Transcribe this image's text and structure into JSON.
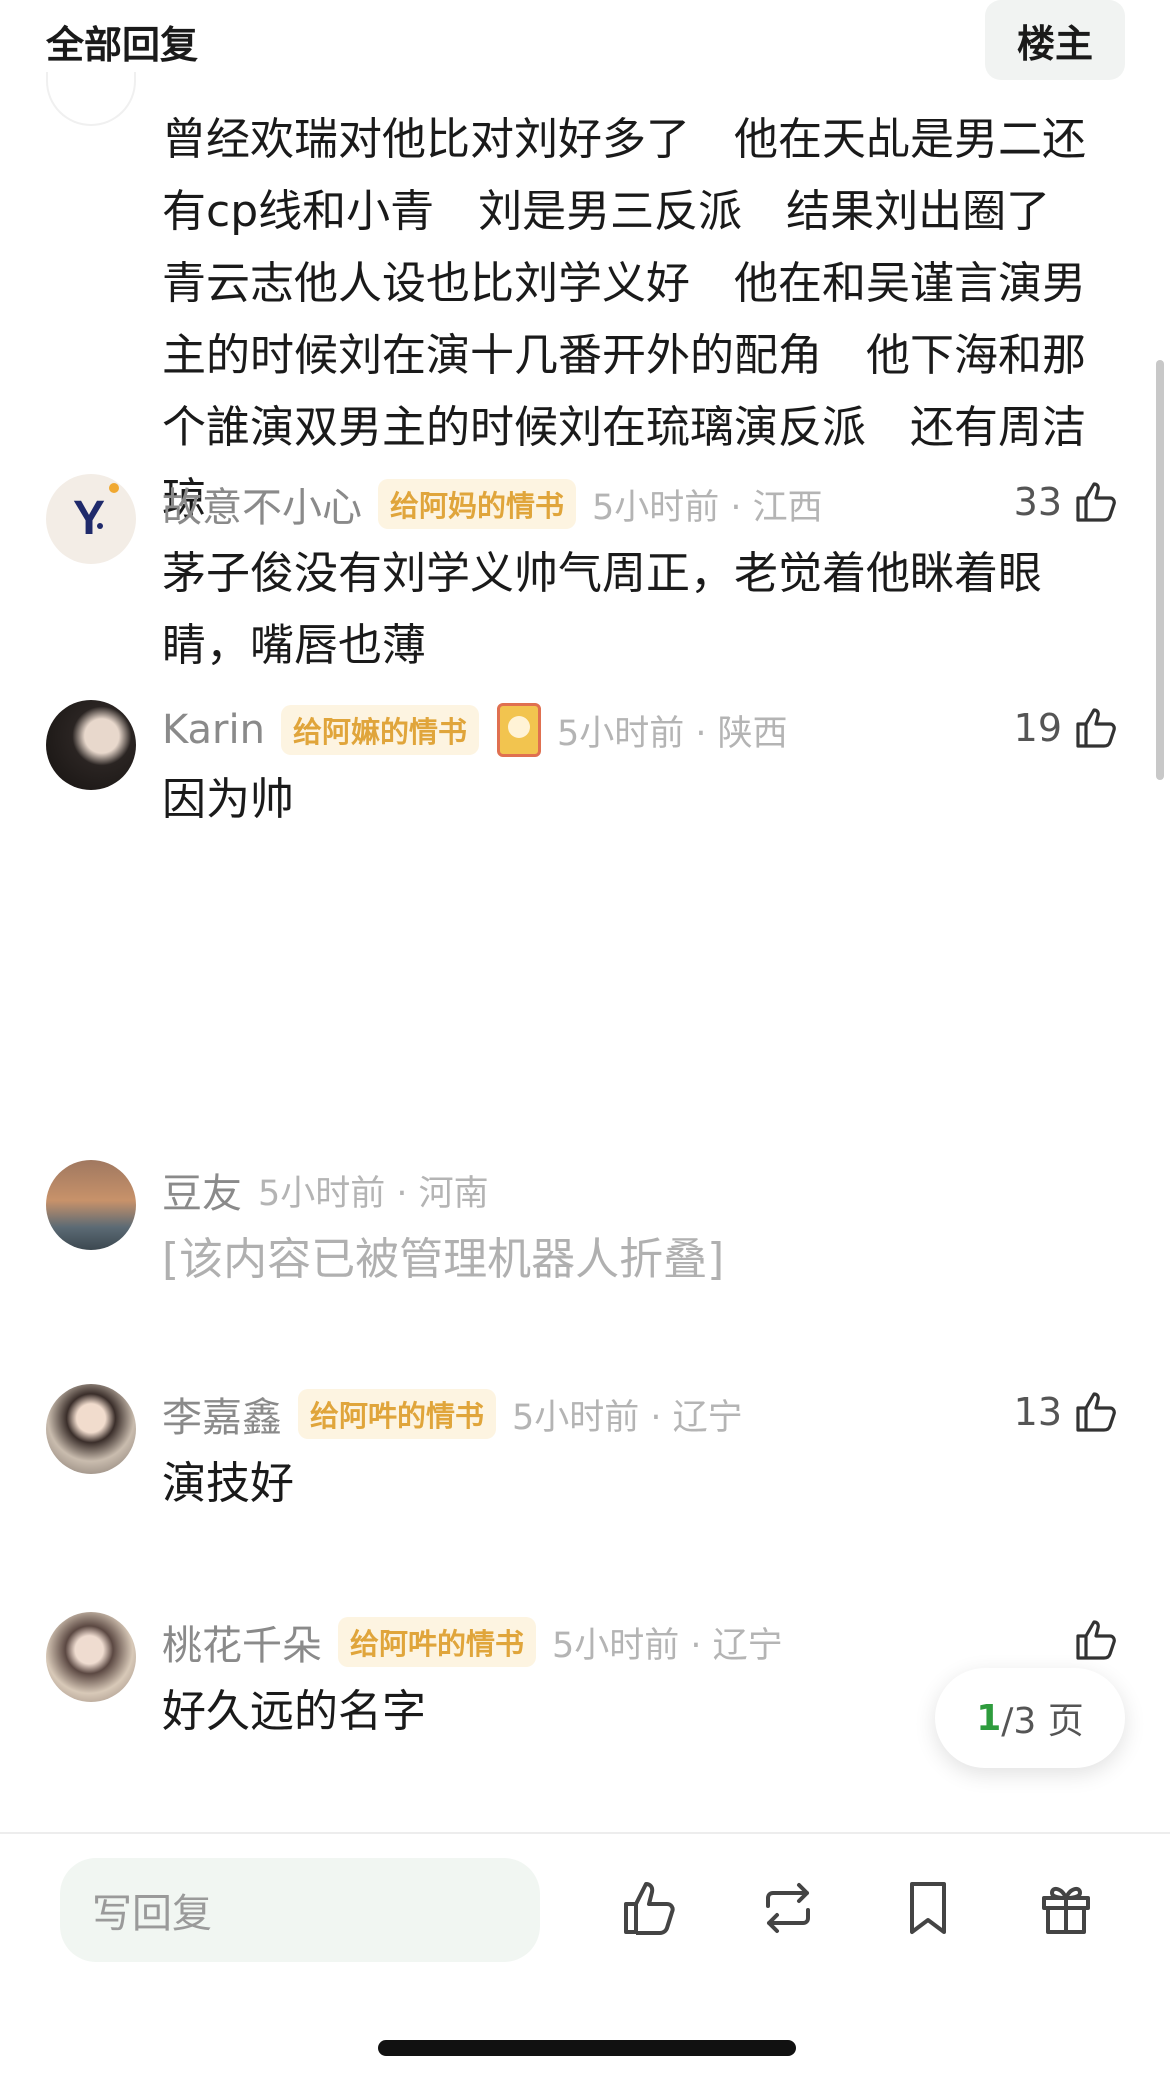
{
  "header": {
    "title": "全部回复",
    "op_button": "楼主"
  },
  "top_comment": {
    "text": "曾经欢瑞对他比对刘好多了　他在天乩是男二还有cp线和小青　刘是男三反派　结果刘出圈了 青云志他人设也比刘学义好　他在和吴谨言演男主的时候刘在演十几番开外的配角　他下海和那个誰演双男主的时候刘在琉璃演反派　还有周洁琼"
  },
  "comments": [
    {
      "name": "故意不小心",
      "badge": "给阿妈的情书",
      "time_location": "5小时前 · 江西",
      "likes": "33",
      "text": "茅子俊没有刘学义帅气周正，老觉着他眯着眼睛，嘴唇也薄",
      "avatar_icon": "y-logo-avatar"
    },
    {
      "name": "Karin",
      "badge": "给阿嫲的情书",
      "time_location": "5小时前 · 陕西",
      "likes": "19",
      "text": "因为帅",
      "avatar_icon": "photo-avatar",
      "sticker_icon": "cat-sticker-icon"
    },
    {
      "name": "豆友",
      "badge": "",
      "time_location": "5小时前 · 河南",
      "likes": "",
      "text": "[该内容已被管理机器人折叠]",
      "avatar_icon": "sunset-avatar"
    },
    {
      "name": "李嘉鑫",
      "badge": "给阿吽的情书",
      "time_location": "5小时前 · 辽宁",
      "likes": "13",
      "text": "演技好",
      "avatar_icon": "photo-avatar"
    },
    {
      "name": "桃花千朵",
      "badge": "给阿吽的情书",
      "time_location": "5小时前 · 辽宁",
      "likes": "",
      "text": "好久远的名字",
      "avatar_icon": "photo-avatar"
    }
  ],
  "pager": {
    "current": "1",
    "total_text": "/3 页"
  },
  "bottom_bar": {
    "reply_placeholder": "写回复",
    "actions": [
      "thumbs-up-icon",
      "repost-icon",
      "bookmark-icon",
      "gift-icon"
    ]
  },
  "colors": {
    "badge_bg": "#fdf4e1",
    "badge_text": "#e0a53b",
    "pager_current": "#2e9c3d",
    "input_bg": "#f1f6f2"
  }
}
